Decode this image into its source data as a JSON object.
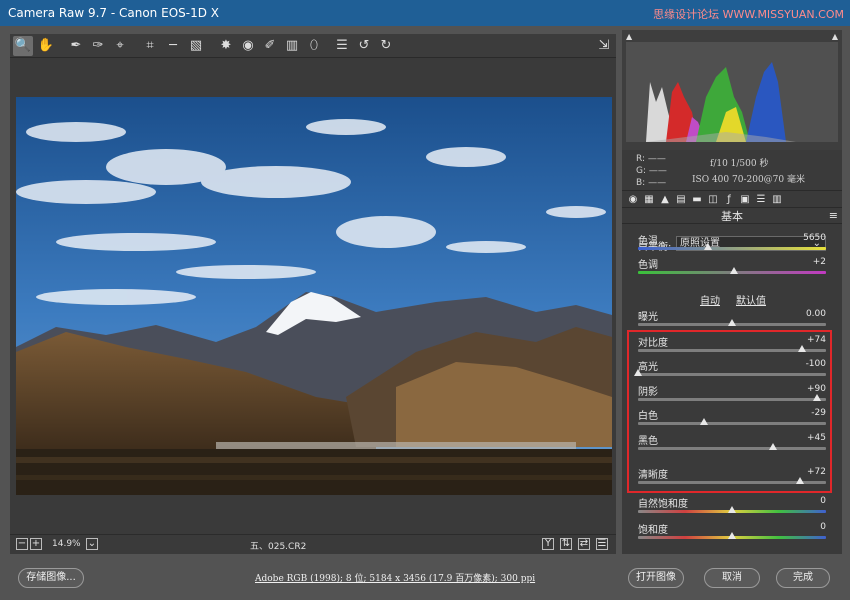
{
  "window": {
    "title": "Camera Raw 9.7  -  Canon EOS-1D X",
    "watermark": "思缘设计论坛 WWW.MISSYUAN.COM"
  },
  "toolbar": {
    "tools": [
      "zoom-icon",
      "hand-icon",
      "white-balance-icon",
      "color-sampler-icon",
      "targeted-adjustment-icon",
      "crop-icon",
      "straighten-icon",
      "transform-icon",
      "spot-removal-icon",
      "red-eye-icon",
      "adjustment-brush-icon",
      "graduated-filter-icon",
      "radial-filter-icon",
      "preferences-icon",
      "rotate-left-icon",
      "rotate-right-icon"
    ],
    "right_tool": "toggle-fullscreen-icon"
  },
  "status": {
    "zoom": "14.9%",
    "filename": "五、025.CR2",
    "buttons": [
      "Y",
      "⇅",
      "⇄",
      "☰"
    ]
  },
  "histogram": {
    "rgb": {
      "r": "R: ——",
      "g": "G: ——",
      "b": "B: ——"
    },
    "exif1": "f/10    1/500 秒",
    "exif2": "ISO 400    70-200@70 毫米"
  },
  "panel": {
    "title": "基本",
    "wb_label": "白平衡:",
    "wb_value": "原照设置",
    "auto": "自动",
    "default": "默认值",
    "sliders": [
      {
        "key": "temp",
        "label": "色温",
        "value": "5650",
        "level": 0.37
      },
      {
        "key": "tint",
        "label": "色调",
        "value": "+2",
        "level": 0.51
      },
      {
        "key": "exposure",
        "label": "曝光",
        "value": "0.00",
        "level": 0.5
      },
      {
        "key": "contrast",
        "label": "对比度",
        "value": "+74",
        "level": 0.87
      },
      {
        "key": "highlights",
        "label": "高光",
        "value": "-100",
        "level": 0.0
      },
      {
        "key": "shadows",
        "label": "阴影",
        "value": "+90",
        "level": 0.95
      },
      {
        "key": "whites",
        "label": "白色",
        "value": "-29",
        "level": 0.35
      },
      {
        "key": "blacks",
        "label": "黑色",
        "value": "+45",
        "level": 0.72
      },
      {
        "key": "clarity",
        "label": "清晰度",
        "value": "+72",
        "level": 0.86
      },
      {
        "key": "vibrance",
        "label": "自然饱和度",
        "value": "0",
        "level": 0.5
      },
      {
        "key": "saturation",
        "label": "饱和度",
        "value": "0",
        "level": 0.5
      }
    ]
  },
  "bottom": {
    "save": "存储图像...",
    "info": "Adobe RGB (1998); 8 位; 5184 x 3456 (17.9 百万像素); 300 ppi",
    "open": "打开图像",
    "cancel": "取消",
    "done": "完成"
  }
}
